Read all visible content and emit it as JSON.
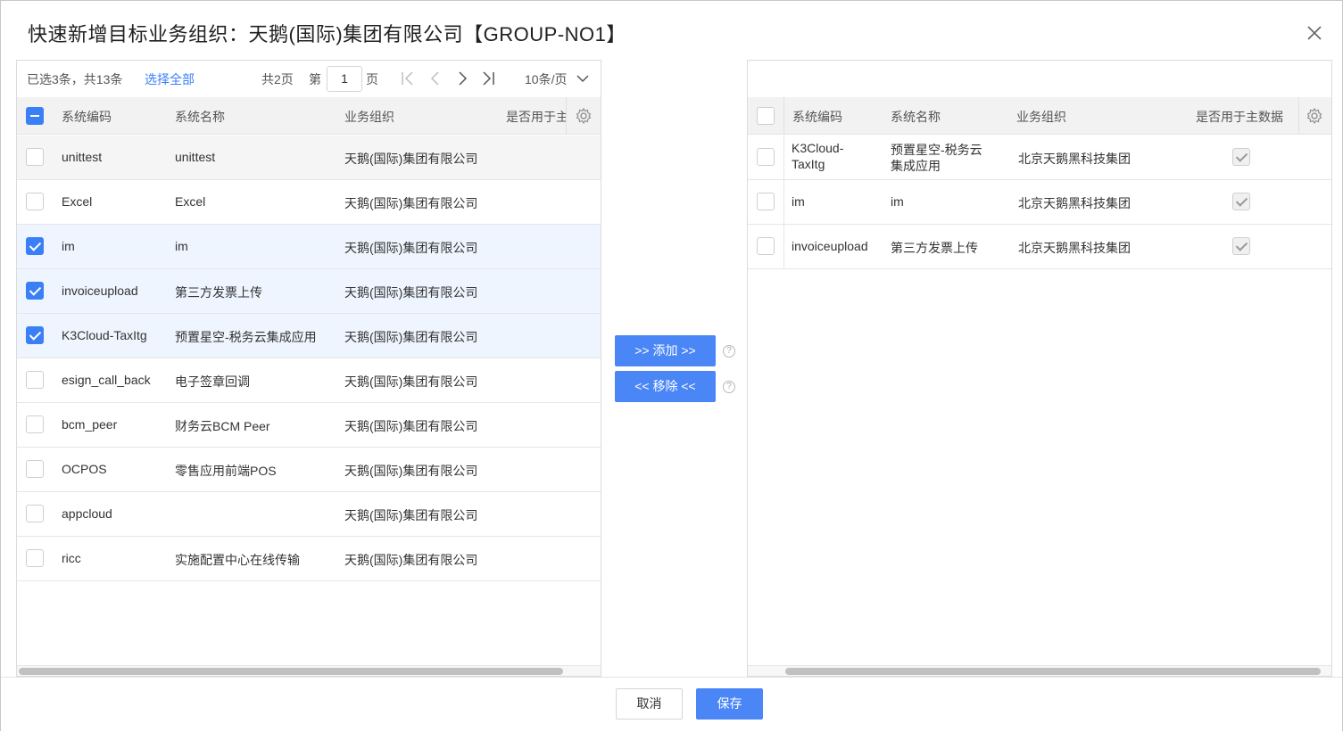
{
  "dialog": {
    "title": "快速新增目标业务组织：天鹅(国际)集团有限公司【GROUP-NO1】"
  },
  "left": {
    "toolbar": {
      "selected_info": "已选3条，共13条",
      "select_all": "选择全部",
      "total_pages": "共2页",
      "page_prefix": "第",
      "page_value": "1",
      "page_suffix": "页",
      "page_size": "10条/页"
    },
    "columns": [
      "系统编码",
      "系统名称",
      "业务组织",
      "是否用于主"
    ],
    "rows": [
      {
        "code": "unittest",
        "name": "unittest",
        "org": "天鹅(国际)集团有限公司"
      },
      {
        "code": "Excel",
        "name": "Excel",
        "org": "天鹅(国际)集团有限公司"
      },
      {
        "code": "im",
        "name": "im",
        "org": "天鹅(国际)集团有限公司"
      },
      {
        "code": "invoiceupload",
        "name": "第三方发票上传",
        "org": "天鹅(国际)集团有限公司"
      },
      {
        "code": "K3Cloud-TaxItg",
        "name": "预置星空-税务云集成应用",
        "org": "天鹅(国际)集团有限公司"
      },
      {
        "code": "esign_call_back",
        "name": "电子签章回调",
        "org": "天鹅(国际)集团有限公司"
      },
      {
        "code": "bcm_peer",
        "name": "财务云BCM Peer",
        "org": "天鹅(国际)集团有限公司"
      },
      {
        "code": "OCPOS",
        "name": "零售应用前端POS",
        "org": "天鹅(国际)集团有限公司"
      },
      {
        "code": "appcloud",
        "name": "",
        "org": "天鹅(国际)集团有限公司"
      },
      {
        "code": "ricc",
        "name": "实施配置中心在线传输",
        "org": "天鹅(国际)集团有限公司"
      }
    ]
  },
  "middle": {
    "add_label": ">> 添加 >>",
    "remove_label": "<< 移除 <<",
    "help_glyph": "?"
  },
  "right": {
    "columns": [
      "系统编码",
      "系统名称",
      "业务组织",
      "是否用于主数据"
    ],
    "rows": [
      {
        "code_line1": "K3Cloud-",
        "code_line2": "TaxItg",
        "name_line1": "预置星空-税务云",
        "name_line2": "集成应用",
        "org": "北京天鹅黑科技集团"
      },
      {
        "code": "im",
        "name": "im",
        "org": "北京天鹅黑科技集团"
      },
      {
        "code": "invoiceupload",
        "name": "第三方发票上传",
        "org": "北京天鹅黑科技集团"
      }
    ]
  },
  "footer": {
    "cancel_label": "取消",
    "save_label": "保存"
  },
  "colors": {
    "accent": "#3a7ff6",
    "button": "#4b86f7"
  }
}
